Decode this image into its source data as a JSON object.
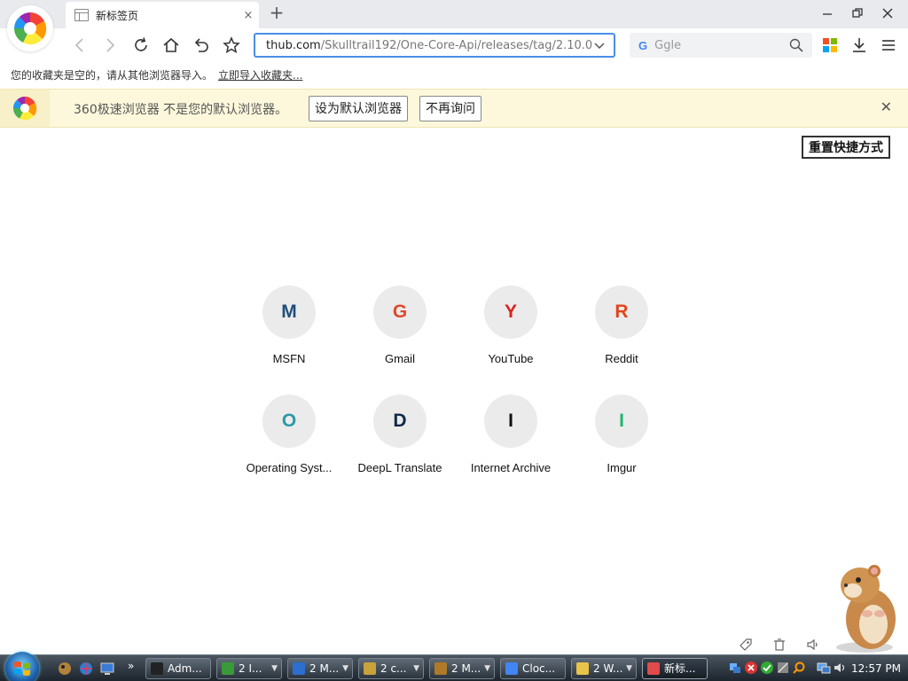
{
  "browser": {
    "tab": {
      "title": "新标签页",
      "close_glyph": "×"
    },
    "newtab_glyph": "+",
    "window_controls": {
      "minimize": "—",
      "maximize": "❐",
      "close": "✕"
    },
    "address": {
      "host": "thub.com",
      "path": "/Skulltrail192/One-Core-Api/releases/tag/2.10.0"
    },
    "search": {
      "engine_letter": "G",
      "placeholder": "Ggle"
    }
  },
  "bookmark_bar": {
    "message": "您的收藏夹是空的，请从其他浏览器导入。",
    "import_link": "立即导入收藏夹..."
  },
  "infobar": {
    "message": "360极速浏览器 不是您的默认浏览器。",
    "set_default": "设为默认浏览器",
    "dont_ask": "不再询问",
    "close_glyph": "✕"
  },
  "content": {
    "reset_button": "重置快捷方式",
    "tiles": [
      {
        "letter": "M",
        "name": "MSFN",
        "color": "#1f4e79"
      },
      {
        "letter": "G",
        "name": "Gmail",
        "color": "#e0482b"
      },
      {
        "letter": "Y",
        "name": "YouTube",
        "color": "#e01f1f"
      },
      {
        "letter": "R",
        "name": "Reddit",
        "color": "#e2451c"
      },
      {
        "letter": "O",
        "name": "Operating Syst...",
        "color": "#2a9aa6"
      },
      {
        "letter": "D",
        "name": "DeepL Translate",
        "color": "#0f2b46"
      },
      {
        "letter": "I",
        "name": "Internet Archive",
        "color": "#111111"
      },
      {
        "letter": "I",
        "name": "Imgur",
        "color": "#1bb76e"
      }
    ]
  },
  "taskbar": {
    "buttons": [
      {
        "label": "Adm...",
        "icon_color": "#222",
        "has_arrow": false
      },
      {
        "label": "2 I...",
        "icon_color": "#3a9a3a",
        "has_arrow": true
      },
      {
        "label": "2 M...",
        "icon_color": "#2d6fd0",
        "has_arrow": true
      },
      {
        "label": "2 c...",
        "icon_color": "#c9a23a",
        "has_arrow": true
      },
      {
        "label": "2 M...",
        "icon_color": "#b07a2a",
        "has_arrow": true
      },
      {
        "label": "Cloc...",
        "icon_color": "#4285f4",
        "has_arrow": false
      },
      {
        "label": "2 W...",
        "icon_color": "#e7c34a",
        "has_arrow": true
      },
      {
        "label": "新标...",
        "icon_color": "#e04a4a",
        "has_arrow": false
      }
    ],
    "overflow_glyph": "»",
    "clock": "12:57 PM"
  }
}
